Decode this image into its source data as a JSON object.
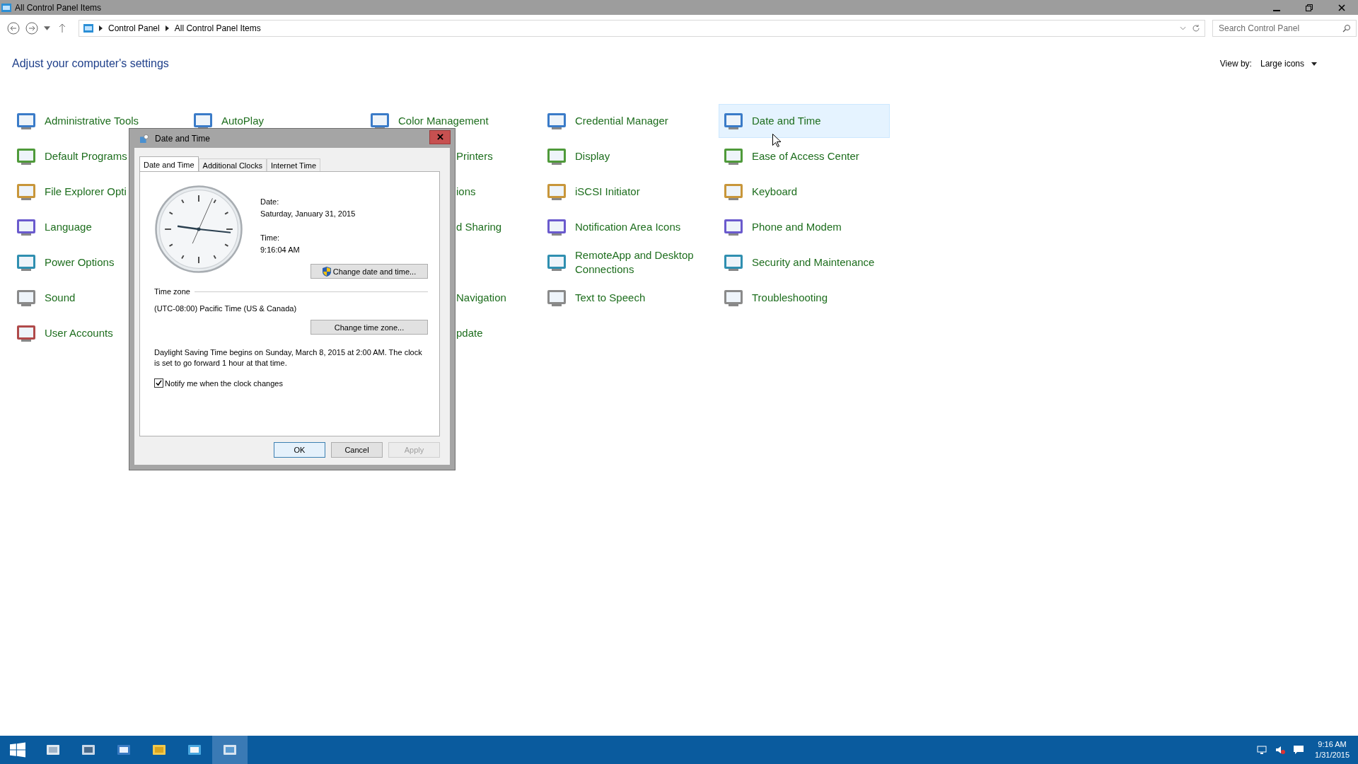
{
  "window": {
    "title": "All Control Panel Items"
  },
  "address": {
    "crumbs": [
      "Control Panel",
      "All Control Panel Items"
    ],
    "search_placeholder": "Search Control Panel"
  },
  "heading": "Adjust your computer's settings",
  "view_by": {
    "label": "View by:",
    "value": "Large icons"
  },
  "columns": [
    [
      {
        "kind": "full",
        "label": "Administrative Tools",
        "highlighted": false
      },
      {
        "kind": "full",
        "label": "Default Programs",
        "highlighted": false
      },
      {
        "kind": "full",
        "label": "File Explorer Opti",
        "highlighted": false
      },
      {
        "kind": "full",
        "label": "Language",
        "highlighted": false
      },
      {
        "kind": "full",
        "label": "Power Options",
        "highlighted": false
      },
      {
        "kind": "full",
        "label": "Sound",
        "highlighted": false
      },
      {
        "kind": "full",
        "label": "User Accounts",
        "highlighted": false
      }
    ],
    [
      {
        "kind": "full",
        "label": "AutoPlay",
        "highlighted": false
      }
    ],
    [
      {
        "kind": "full",
        "label": "Color Management",
        "highlighted": false
      },
      {
        "kind": "covered",
        "label": "Printers"
      },
      {
        "kind": "covered",
        "label": "ions"
      },
      {
        "kind": "covered",
        "label": "d Sharing"
      },
      {
        "kind": "hidden"
      },
      {
        "kind": "covered",
        "label": "Navigation"
      },
      {
        "kind": "covered",
        "label": "pdate"
      }
    ],
    [
      {
        "kind": "full",
        "label": "Credential Manager",
        "highlighted": false
      },
      {
        "kind": "full",
        "label": "Display",
        "highlighted": false
      },
      {
        "kind": "full",
        "label": "iSCSI Initiator",
        "highlighted": false
      },
      {
        "kind": "full",
        "label": "Notification Area Icons",
        "highlighted": false
      },
      {
        "kind": "full",
        "label": "RemoteApp and Desktop Connections",
        "highlighted": false
      },
      {
        "kind": "full",
        "label": "Text to Speech",
        "highlighted": false
      }
    ],
    [
      {
        "kind": "full",
        "label": "Date and Time",
        "highlighted": true
      },
      {
        "kind": "full",
        "label": "Ease of Access Center",
        "highlighted": false
      },
      {
        "kind": "full",
        "label": "Keyboard",
        "highlighted": false
      },
      {
        "kind": "full",
        "label": "Phone and Modem",
        "highlighted": false
      },
      {
        "kind": "full",
        "label": "Security and Maintenance",
        "highlighted": false
      },
      {
        "kind": "full",
        "label": "Troubleshooting",
        "highlighted": false
      }
    ]
  ],
  "dialog": {
    "title": "Date and Time",
    "tabs": [
      {
        "label": "Date and Time",
        "selected": true
      },
      {
        "label": "Additional Clocks",
        "selected": false
      },
      {
        "label": "Internet Time",
        "selected": false
      }
    ],
    "date_label": "Date:",
    "date": "Saturday, January 31, 2015",
    "time_label": "Time:",
    "time": "9:16:04 AM",
    "change_date_button": "Change date and time...",
    "timezone_label": "Time zone",
    "timezone": "(UTC-08:00) Pacific Time (US & Canada)",
    "change_timezone_button": "Change time zone...",
    "dst_note": "Daylight Saving Time begins on Sunday, March 8, 2015 at 2:00 AM. The clock is set to go forward 1 hour at that time.",
    "notify": {
      "label": "Notify me when the clock changes",
      "checked": true
    },
    "buttons": [
      {
        "label": "OK",
        "default": true,
        "disabled": false
      },
      {
        "label": "Cancel",
        "default": false,
        "disabled": false
      },
      {
        "label": "Apply",
        "default": false,
        "disabled": true
      }
    ]
  },
  "taskbar": {
    "apps": [
      {
        "selected": false
      },
      {
        "selected": false
      },
      {
        "selected": false
      },
      {
        "selected": false
      },
      {
        "selected": false
      },
      {
        "selected": true
      }
    ],
    "time": "9:16 AM",
    "date": "1/31/2015"
  }
}
